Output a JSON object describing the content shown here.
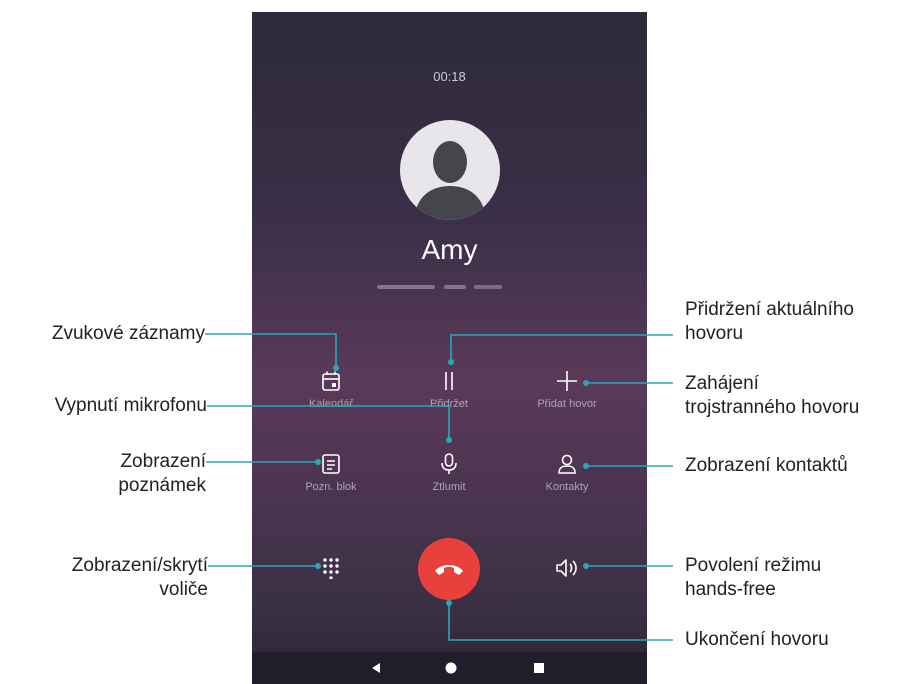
{
  "call": {
    "timer": "00:18",
    "contact_name": "Amy"
  },
  "buttons": {
    "calendar": "Kalendář",
    "hold": "Přidržet",
    "add_call": "Přidat hovor",
    "notepad": "Pozn. blok",
    "mute": "Ztlumit",
    "contacts": "Kontakty"
  },
  "annotations": {
    "recordings": "Zvukové záznamy",
    "mute_mic": "Vypnutí mikrofonu",
    "notes_1": "Zobrazení",
    "notes_2": "poznámek",
    "dialpad_1": "Zobrazení/skrytí",
    "dialpad_2": "voliče",
    "hold_1": "Přidržení aktuálního",
    "hold_2": "hovoru",
    "conf_1": "Zahájení",
    "conf_2": "trojstranného hovoru",
    "contacts": "Zobrazení kontaktů",
    "speaker_1": "Povolení režimu",
    "speaker_2": "hands-free",
    "end_call": "Ukončení hovoru"
  },
  "icons": {
    "calendar": "calendar-icon",
    "hold": "pause-icon",
    "add_call": "plus-icon",
    "notepad": "notepad-icon",
    "mute": "microphone-icon",
    "contacts": "person-icon",
    "dialpad": "dialpad-icon",
    "end_call": "phone-hangup-icon",
    "speaker": "speaker-icon",
    "back": "back-triangle-icon",
    "home": "home-circle-icon",
    "recents": "recents-square-icon"
  },
  "colors": {
    "end_call": "#e8403a",
    "leader_line": "#2aa6b8",
    "screen_text": "#ffffff"
  }
}
